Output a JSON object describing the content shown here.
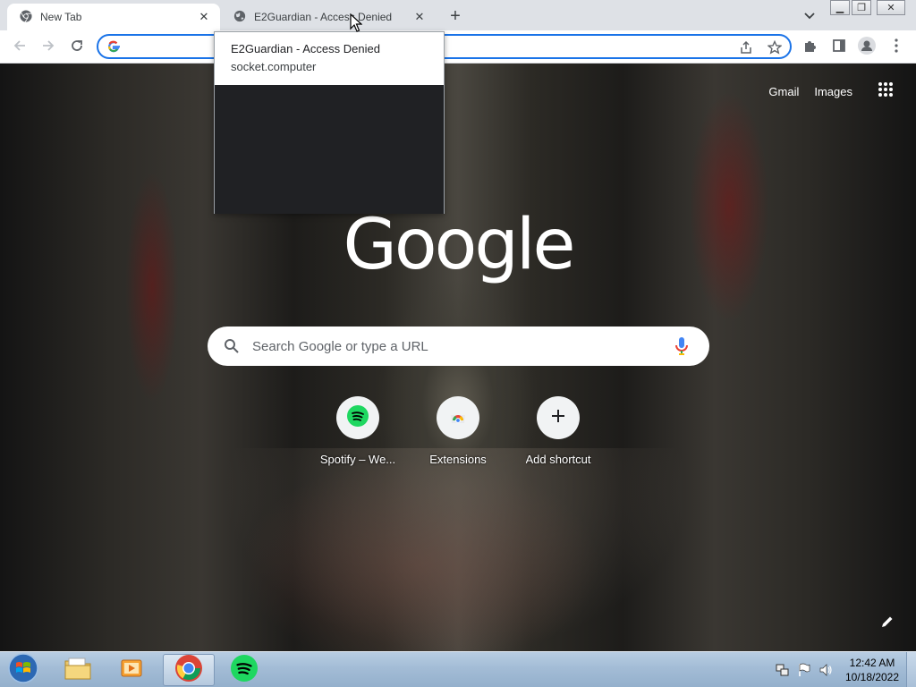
{
  "browser": {
    "tabs": [
      {
        "title": "New Tab",
        "active": true,
        "icon": "chrome-icon"
      },
      {
        "title": "E2Guardian - Access Denied",
        "active": false,
        "icon": "globe-icon"
      }
    ],
    "omnibox": {
      "value": "",
      "placeholder": ""
    },
    "accent_color": "#1a73e8"
  },
  "hover_card": {
    "title": "E2Guardian - Access Denied",
    "domain": "socket.computer"
  },
  "ntp": {
    "top_links": {
      "gmail": "Gmail",
      "images": "Images"
    },
    "logo": "Google",
    "search": {
      "placeholder": "Search Google or type a URL",
      "value": ""
    },
    "shortcuts": [
      {
        "label": "Spotify – We...",
        "icon": "spotify-icon"
      },
      {
        "label": "Extensions",
        "icon": "chrome-web-store-icon"
      },
      {
        "label": "Add shortcut",
        "icon": "plus-icon"
      }
    ]
  },
  "taskbar": {
    "pinned": [
      "explorer-icon",
      "media-player-icon",
      "chrome-icon",
      "spotify-icon"
    ],
    "clock": {
      "time": "12:42 AM",
      "date": "10/18/2022"
    }
  }
}
